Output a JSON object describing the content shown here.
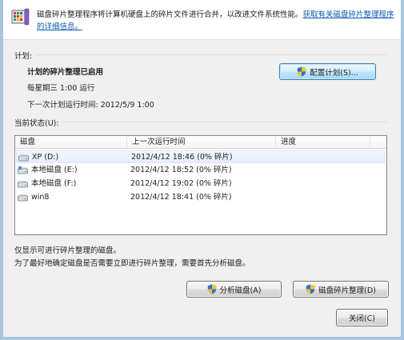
{
  "header": {
    "description": "磁盘碎片整理程序将计算机硬盘上的碎片文件进行合并，以改进文件系统性能。",
    "link": "获取有关磁盘碎片整理程序的详细信息。"
  },
  "schedule": {
    "section_label": "计划:",
    "title": "计划的碎片整理已启用",
    "frequency": "每星期三 1:00 运行",
    "next_run": "下一次计划运行时间: 2012/5/9 1:00",
    "configure_button": "配置计划(S)..."
  },
  "status": {
    "section_label": "当前状态(U):",
    "columns": [
      "磁盘",
      "上一次运行时间",
      "进度"
    ],
    "rows": [
      {
        "disk": "XP (D:)",
        "last_run": "2012/4/12 18:46 (0% 碎片)",
        "progress": "",
        "icon": "hard-drive-icon"
      },
      {
        "disk": "本地磁盘 (E:)",
        "last_run": "2012/4/12 18:52 (0% 碎片)",
        "progress": "",
        "icon": "hard-drive-icon"
      },
      {
        "disk": "本地磁盘 (F:)",
        "last_run": "2012/4/12 19:02 (0% 碎片)",
        "progress": "",
        "icon": "hard-drive-icon"
      },
      {
        "disk": "win8",
        "last_run": "2012/4/12 18:41 (0% 碎片)",
        "progress": "",
        "icon": "hard-drive-icon"
      }
    ]
  },
  "notes": {
    "line1": "仅显示可进行碎片整理的磁盘。",
    "line2": "为了最好地确定磁盘是否需要立即进行碎片整理，需要首先分析磁盘。"
  },
  "buttons": {
    "analyze": "分析磁盘(A)",
    "defrag": "磁盘碎片整理(D)",
    "close": "关闭(C)"
  },
  "colors": {
    "link": "#0b5cad",
    "selection": "#e4eefb",
    "frame": "#a9c4de"
  }
}
